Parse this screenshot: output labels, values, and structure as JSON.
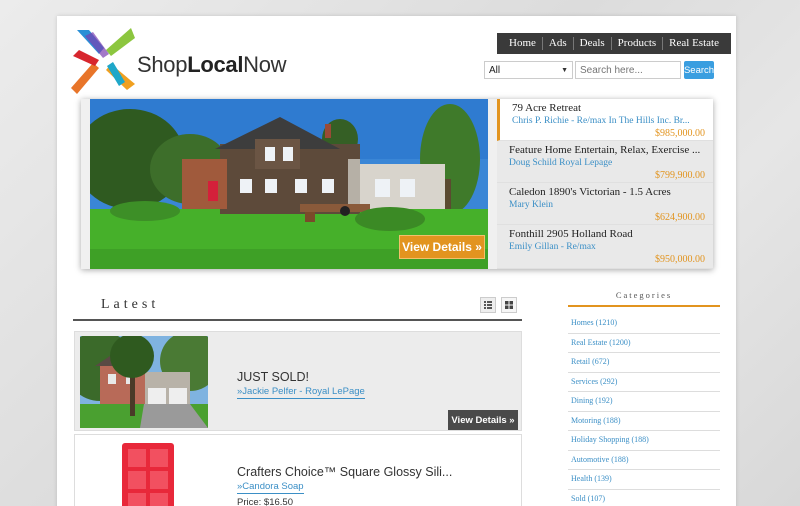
{
  "brand": {
    "name_prefix": "Shop",
    "name_bold": "Local",
    "name_suffix": "Now"
  },
  "nav": {
    "items": [
      "Home",
      "Ads",
      "Deals",
      "Products",
      "Real Estate"
    ]
  },
  "search": {
    "category_selected": "All",
    "placeholder": "Search here...",
    "button_label": "Search"
  },
  "featured": {
    "view_details_label": "View Details »",
    "listings": [
      {
        "title": "79 Acre Retreat",
        "agent": "Chris P. Richie - Re/max In The Hills Inc. Br...",
        "price": "$985,000.00"
      },
      {
        "title": "Feature Home Entertain, Relax, Exercise ...",
        "agent": "Doug Schild Royal Lepage",
        "price": "$799,900.00"
      },
      {
        "title": "Caledon 1890's Victorian - 1.5 Acres",
        "agent": "Mary Klein",
        "price": "$624,900.00"
      },
      {
        "title": "Fonthill 2905 Holland Road",
        "agent": "Emily Gillan - Re/max",
        "price": "$950,000.00"
      }
    ]
  },
  "latest": {
    "title": "Latest",
    "items": [
      {
        "title": "JUST SOLD!",
        "seller": "»Jackie Pelfer - Royal LePage",
        "price": "",
        "view_label": "View Details »"
      },
      {
        "title": "Crafters Choice™ Square Glossy Sili...",
        "seller": "»Candora Soap",
        "price": "Price: $16.50"
      }
    ]
  },
  "categories": {
    "title": "Categories",
    "items": [
      "Homes (1210)",
      "Real Estate (1200)",
      "Retail (672)",
      "Services (292)",
      "Dining (192)",
      "Motoring (188)",
      "Holiday Shopping (188)",
      "Automotive (188)",
      "Health (139)",
      "Sold (107)"
    ]
  },
  "colors": {
    "accent_orange": "#e2941f",
    "link_blue": "#3b8fc6",
    "nav_dark": "#3a3a3a",
    "search_blue": "#3a9ee0"
  }
}
